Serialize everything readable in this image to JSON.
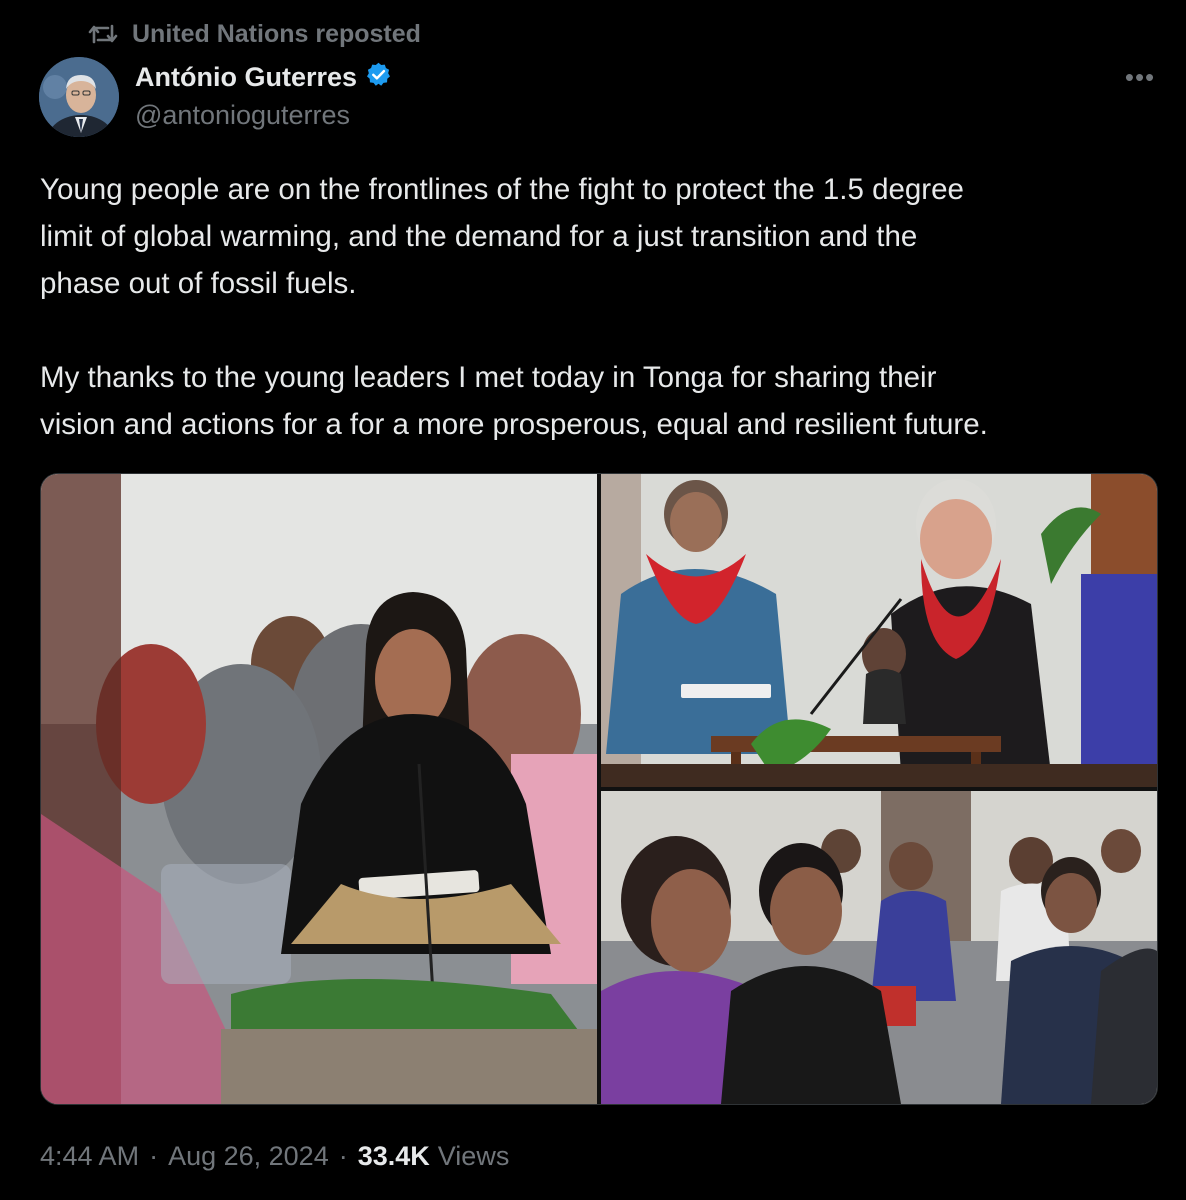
{
  "repost": {
    "label": "United Nations reposted",
    "icon": "repost-icon"
  },
  "author": {
    "display_name": "António Guterres",
    "handle": "@antonioguterres",
    "verified": true,
    "verified_icon": "verified-badge-icon",
    "verified_color": "#1d9bf0"
  },
  "tweet": {
    "paragraphs": [
      "Young people are on the frontlines of the fight to protect the 1.5 degree\nlimit of global warming, and the demand for a just transition and the\nphase out of fossil fuels.",
      "My thanks to the young leaders I met today in Tonga for sharing their\nvision and actions for a for a more prosperous, equal and resilient future."
    ]
  },
  "media": {
    "count": 3
  },
  "meta": {
    "time": "4:44 AM",
    "separator": "·",
    "date": "Aug 26, 2024",
    "views_count": "33.4K",
    "views_label": "Views"
  },
  "colors": {
    "background": "#000000",
    "text_primary": "#e7e9ea",
    "text_secondary": "#71767b",
    "border": "#2f3336"
  }
}
